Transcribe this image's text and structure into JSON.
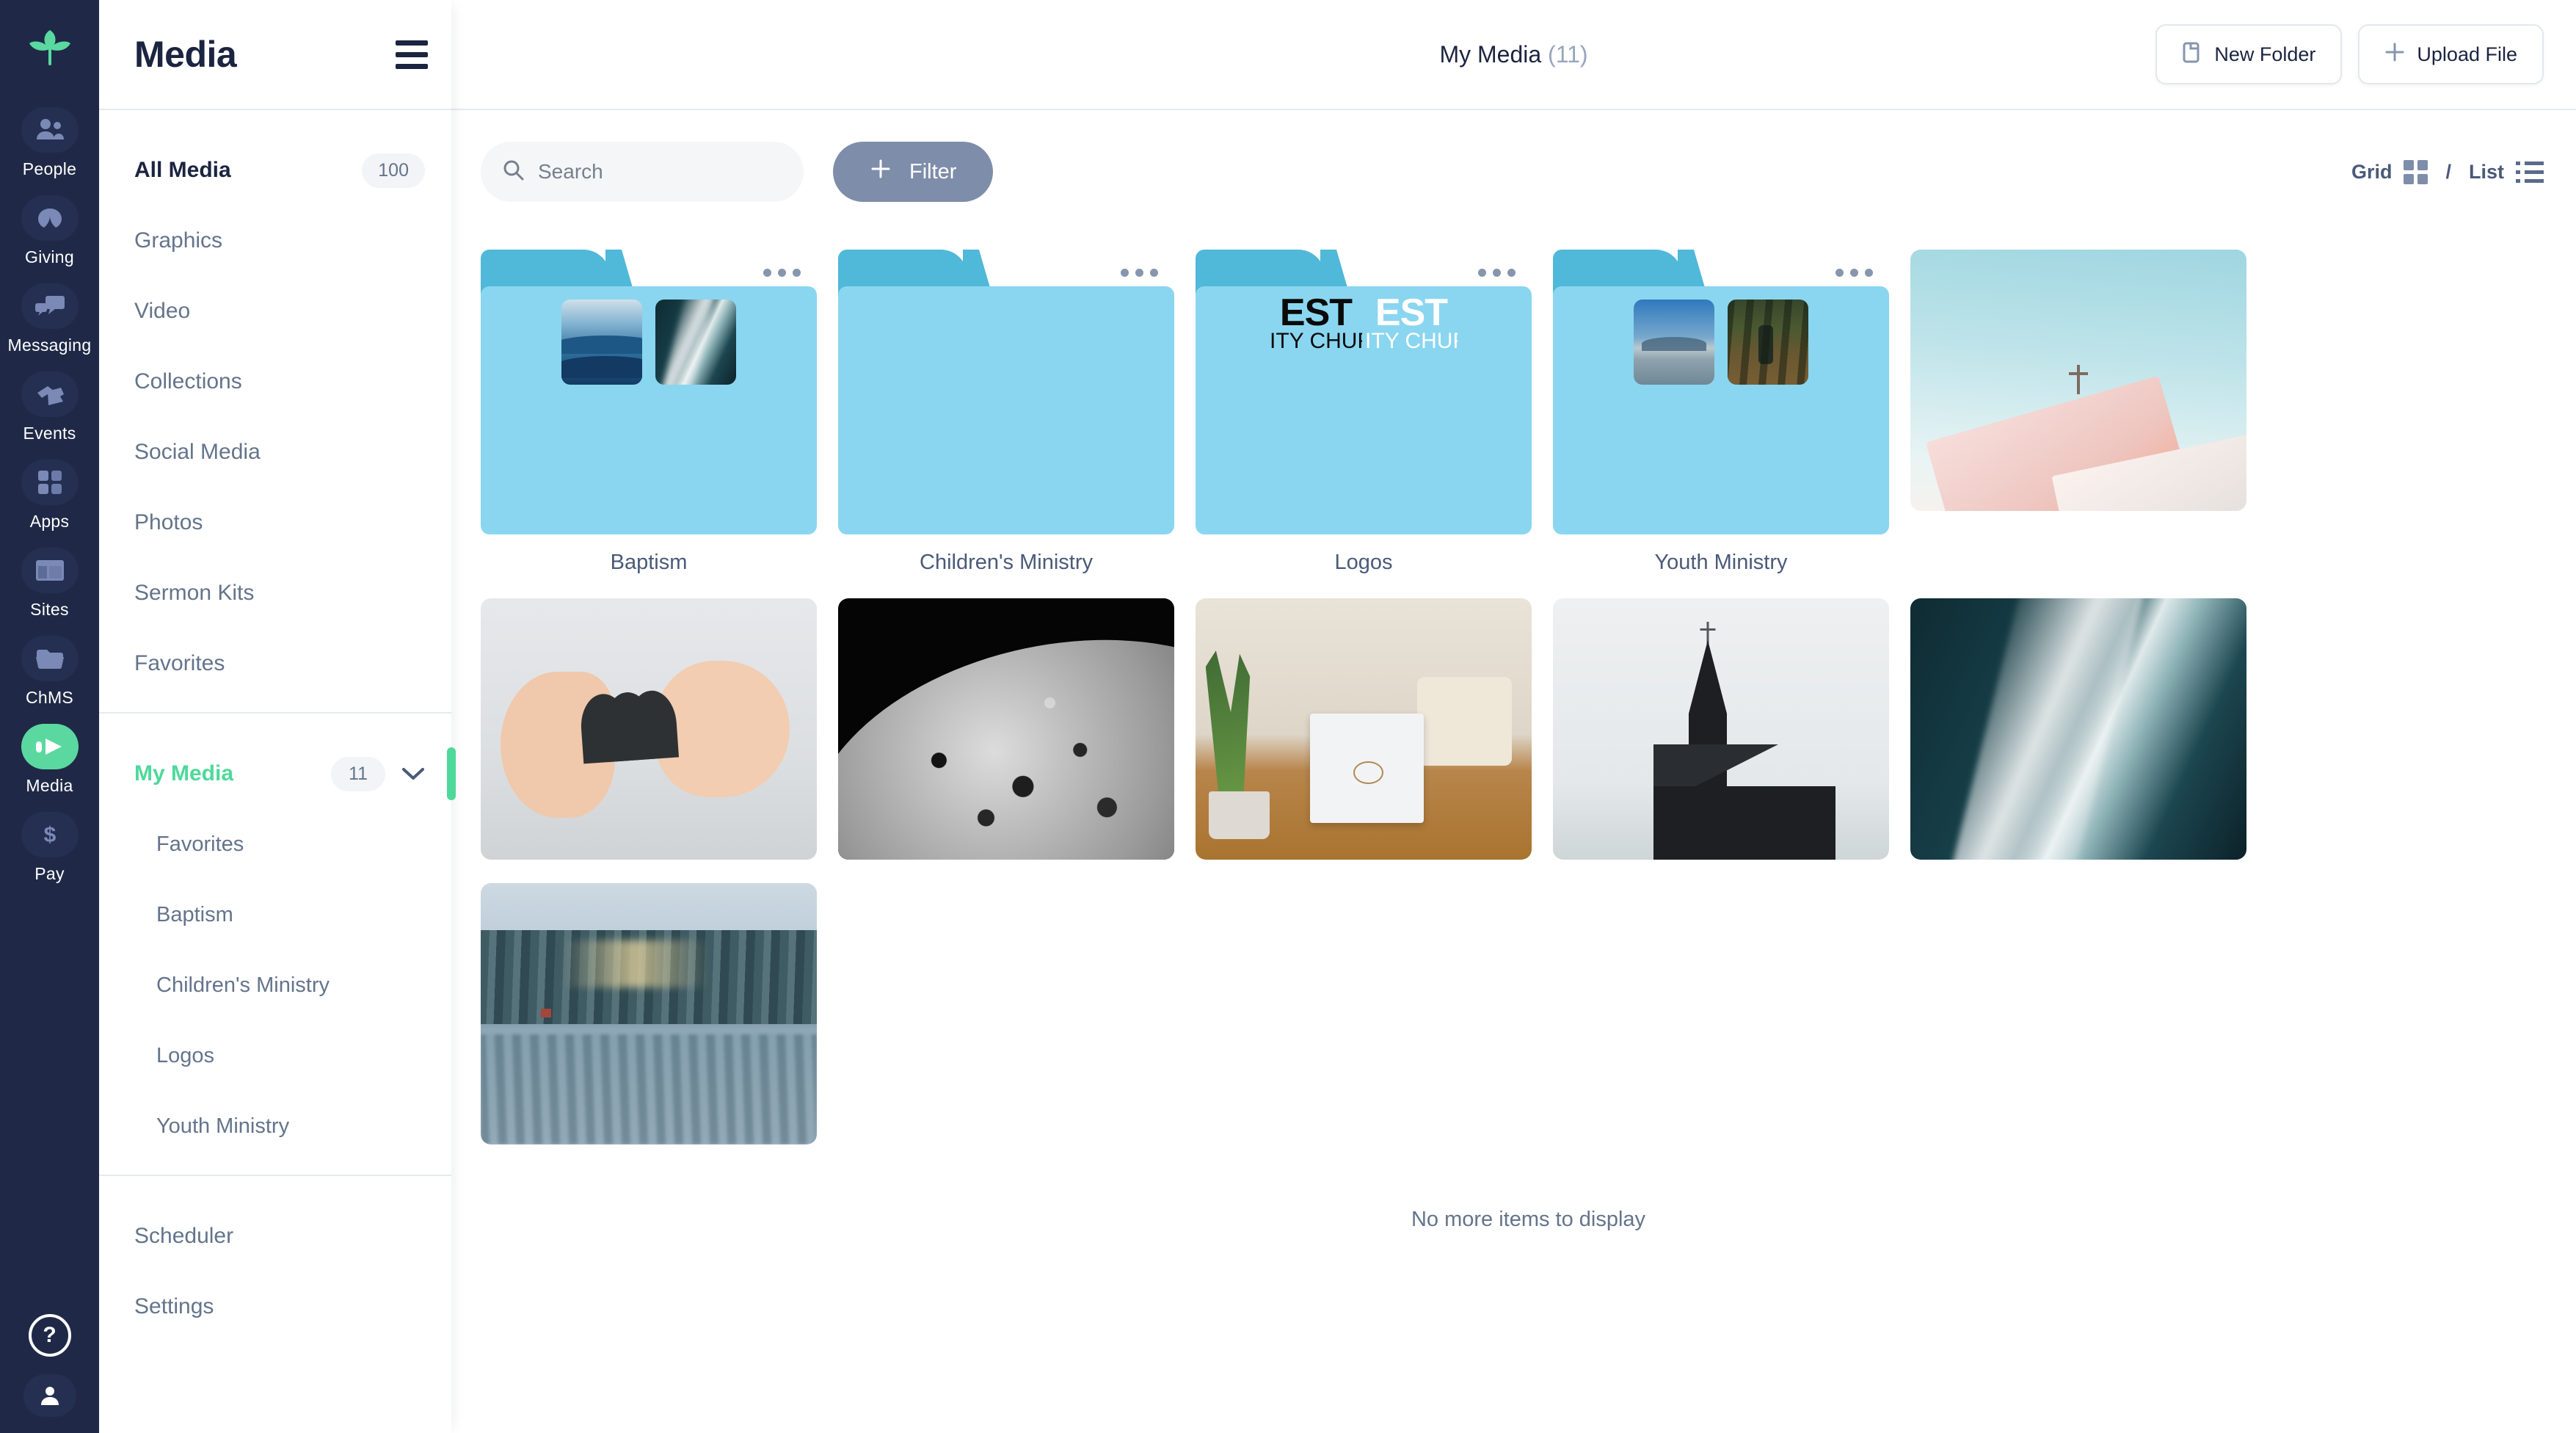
{
  "rail": {
    "logo_icon": "sprout-logo",
    "items": [
      {
        "label": "People",
        "icon": "people-icon",
        "active": false
      },
      {
        "label": "Giving",
        "icon": "leaf-icon",
        "active": false
      },
      {
        "label": "Messaging",
        "icon": "chat-icon",
        "active": false
      },
      {
        "label": "Events",
        "icon": "ticket-icon",
        "active": false
      },
      {
        "label": "Apps",
        "icon": "grid-apps-icon",
        "active": false
      },
      {
        "label": "Sites",
        "icon": "layout-icon",
        "active": false
      },
      {
        "label": "ChMS",
        "icon": "folder-icon",
        "active": false
      },
      {
        "label": "Media",
        "icon": "play-icon",
        "active": true
      },
      {
        "label": "Pay",
        "icon": "dollar-icon",
        "active": false
      }
    ],
    "help_icon": "question-mark-icon",
    "avatar_icon": "user-avatar-icon",
    "active_color": "#5ad8a0",
    "background_color": "#1f2947"
  },
  "sidebar": {
    "title": "Media",
    "menu_icon": "hamburger-menu-icon",
    "primary": [
      {
        "label": "All Media",
        "count": "100",
        "strong": true
      },
      {
        "label": "Graphics",
        "count": ""
      },
      {
        "label": "Video",
        "count": ""
      },
      {
        "label": "Collections",
        "count": ""
      },
      {
        "label": "Social Media",
        "count": ""
      },
      {
        "label": "Photos",
        "count": ""
      },
      {
        "label": "Sermon Kits",
        "count": ""
      },
      {
        "label": "Favorites",
        "count": ""
      }
    ],
    "my_media": {
      "label": "My Media",
      "count": "11",
      "chevron_icon": "chevron-down-icon",
      "accent_color": "#4ed99a"
    },
    "my_media_children": [
      {
        "label": "Favorites"
      },
      {
        "label": "Baptism"
      },
      {
        "label": "Children's Ministry"
      },
      {
        "label": "Logos"
      },
      {
        "label": "Youth Ministry"
      }
    ],
    "footer": [
      {
        "label": "Scheduler"
      },
      {
        "label": "Settings"
      }
    ]
  },
  "topbar": {
    "title": "My Media",
    "count": "(11)",
    "new_folder_label": "New Folder",
    "new_folder_icon": "folder-icon",
    "upload_label": "Upload File",
    "upload_icon": "plus-icon"
  },
  "toolbar": {
    "search_placeholder": "Search",
    "search_value": "",
    "search_icon": "search-icon",
    "filter_label": "Filter",
    "filter_icon": "plus-icon",
    "filter_color": "#7e8da9",
    "grid_label": "Grid",
    "grid_icon": "grid-view-icon",
    "separator": "/",
    "list_label": "List",
    "list_icon": "list-view-icon"
  },
  "grid": {
    "folders": [
      {
        "name": "Baptism",
        "menu_icon": "more-options-icon",
        "thumbs": [
          "waves-art",
          "ocean-art"
        ]
      },
      {
        "name": "Children's Ministry",
        "menu_icon": "more-options-icon",
        "thumbs": []
      },
      {
        "name": "Logos",
        "menu_icon": "more-options-icon",
        "thumbs": [
          "logo-dark",
          "logo-light"
        ],
        "logo_line1": "EST",
        "logo_line2": "ITY CHUF"
      },
      {
        "name": "Youth Ministry",
        "menu_icon": "more-options-icon",
        "thumbs": [
          "lake-art",
          "trail-art"
        ]
      }
    ],
    "media": [
      {
        "alt": "pink-church-photo"
      },
      {
        "alt": "hands-heart-photo"
      },
      {
        "alt": "moon-surface-photo"
      },
      {
        "alt": "desk-laptop-photo"
      },
      {
        "alt": "black-church-photo"
      },
      {
        "alt": "ocean-foam-photo"
      },
      {
        "alt": "winter-lake-photo"
      }
    ],
    "end_message": "No more items to display"
  }
}
